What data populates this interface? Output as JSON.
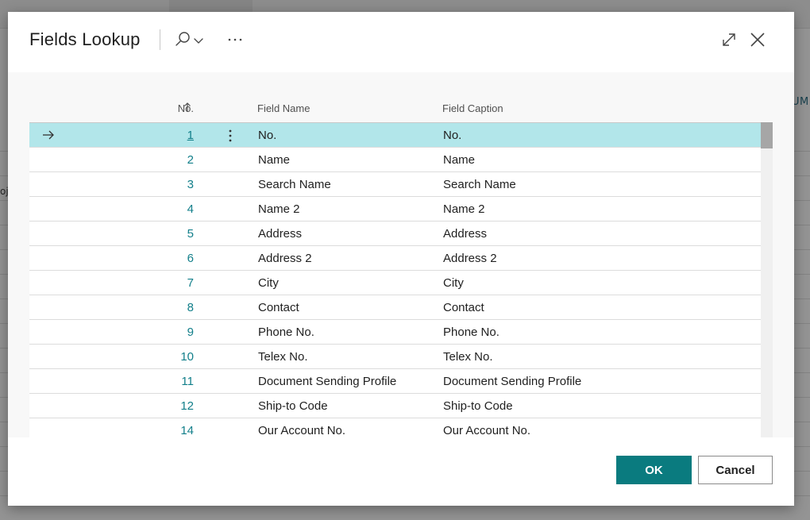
{
  "dialog": {
    "title": "Fields Lookup",
    "icons": {
      "search": "search-icon",
      "chevron": "chevron-down-icon",
      "more": "more-options-icon",
      "expand": "expand-icon",
      "close": "close-icon"
    }
  },
  "table": {
    "headers": {
      "no": "No.",
      "field_name": "Field Name",
      "field_caption": "Field Caption"
    },
    "sort": {
      "column": "No.",
      "direction": "ascending"
    },
    "selected_row_index": 0,
    "rows": [
      {
        "no": "1",
        "field_name": "No.",
        "field_caption": "No."
      },
      {
        "no": "2",
        "field_name": "Name",
        "field_caption": "Name"
      },
      {
        "no": "3",
        "field_name": "Search Name",
        "field_caption": "Search Name"
      },
      {
        "no": "4",
        "field_name": "Name 2",
        "field_caption": "Name 2"
      },
      {
        "no": "5",
        "field_name": "Address",
        "field_caption": "Address"
      },
      {
        "no": "6",
        "field_name": "Address 2",
        "field_caption": "Address 2"
      },
      {
        "no": "7",
        "field_name": "City",
        "field_caption": "City"
      },
      {
        "no": "8",
        "field_name": "Contact",
        "field_caption": "Contact"
      },
      {
        "no": "9",
        "field_name": "Phone No.",
        "field_caption": "Phone No."
      },
      {
        "no": "10",
        "field_name": "Telex No.",
        "field_caption": "Telex No."
      },
      {
        "no": "11",
        "field_name": "Document Sending Profile",
        "field_caption": "Document Sending Profile"
      },
      {
        "no": "12",
        "field_name": "Ship-to Code",
        "field_caption": "Ship-to Code"
      },
      {
        "no": "14",
        "field_name": "Our Account No.",
        "field_caption": "Our Account No."
      }
    ]
  },
  "footer": {
    "ok_label": "OK",
    "cancel_label": "Cancel"
  },
  "background": {
    "right_edge_text": "UM",
    "left_edge_text": "oj"
  },
  "colors": {
    "accent": "#0a7b7f",
    "link": "#127f8a",
    "selected_row": "#b2e6ea"
  }
}
